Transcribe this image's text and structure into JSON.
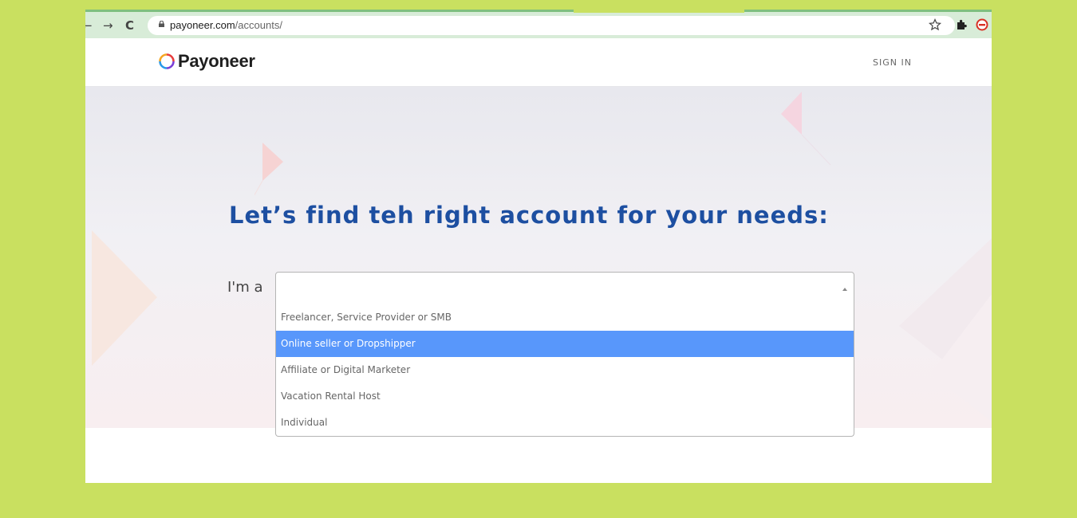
{
  "browser": {
    "url_host": "payoneer.com",
    "url_path": "/accounts/",
    "back_icon": "back-arrow-icon",
    "forward_icon": "forward-arrow-icon",
    "reload_icon": "reload-icon",
    "back_glyph": "←",
    "forward_glyph": "→",
    "reload_glyph": "C"
  },
  "header": {
    "logo_text": "Payoneer",
    "sign_in_label": "SIGN IN"
  },
  "hero": {
    "headline": "Let’s find teh right account for your needs:",
    "select_label": "I'm a",
    "selected_value": "",
    "options": [
      {
        "label": "Freelancer, Service Provider or SMB",
        "highlighted": false
      },
      {
        "label": "Online seller or Dropshipper",
        "highlighted": true
      },
      {
        "label": "Affiliate or Digital Marketer",
        "highlighted": false
      },
      {
        "label": "Vacation Rental Host",
        "highlighted": false
      },
      {
        "label": "Individual",
        "highlighted": false
      }
    ]
  },
  "colors": {
    "page_background": "#c9e060",
    "headline": "#1d4fa1",
    "highlight": "#5897fb"
  }
}
